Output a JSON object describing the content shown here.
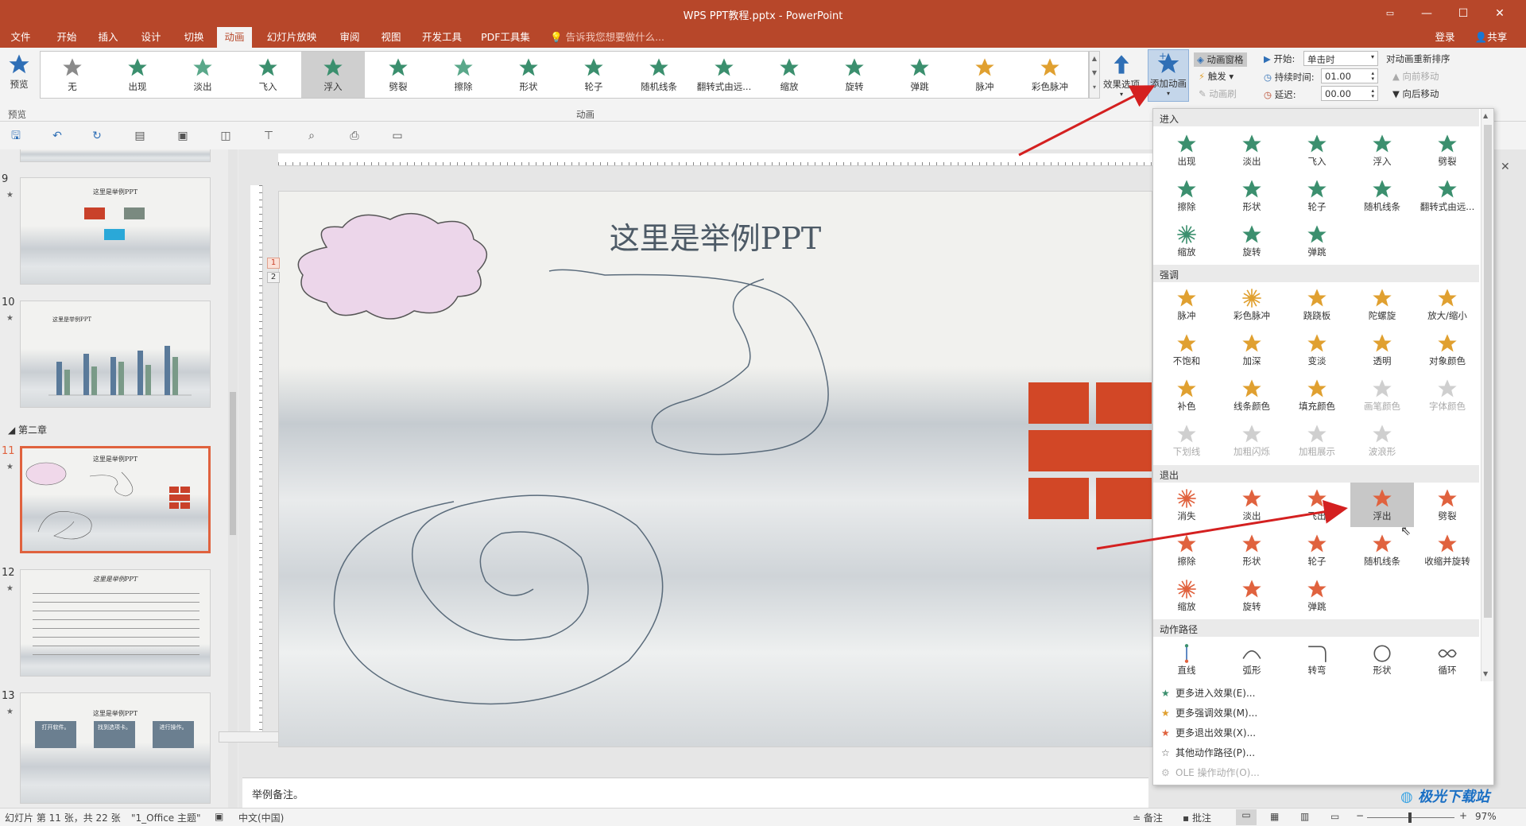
{
  "window": {
    "title": "WPS PPT教程.pptx - PowerPoint"
  },
  "menu": {
    "tabs": [
      "文件",
      "开始",
      "插入",
      "设计",
      "切换",
      "动画",
      "幻灯片放映",
      "审阅",
      "视图",
      "开发工具",
      "PDF工具集"
    ],
    "active": "动画",
    "tell_me": "告诉我您想要做什么...",
    "login": "登录",
    "share": "共享"
  },
  "ribbon": {
    "preview_label": "预览",
    "preview_group": "预览",
    "animation_group": "动画",
    "gallery": [
      "无",
      "出现",
      "淡出",
      "飞入",
      "浮入",
      "劈裂",
      "擦除",
      "形状",
      "轮子",
      "随机线条",
      "翻转式由远...",
      "缩放",
      "旋转",
      "弹跳",
      "脉冲",
      "彩色脉冲"
    ],
    "gallery_selected": "浮入",
    "effect_options": "效果选项",
    "add_animation": "添加动画",
    "animation_pane": "动画窗格",
    "trigger": "触发",
    "anim_painter": "动画刷",
    "start_label": "开始:",
    "start_value": "单击时",
    "duration_label": "持续时间:",
    "duration_value": "01.00",
    "delay_label": "延迟:",
    "delay_value": "00.00",
    "reorder_title": "对动画重新排序",
    "move_earlier": "向前移动",
    "move_later": "向后移动"
  },
  "slides": [
    {
      "num": "9",
      "title": "这里是举例PPT"
    },
    {
      "num": "10",
      "title": "这里是举例PPT"
    },
    {
      "num": "11",
      "title": "这里是举例PPT"
    },
    {
      "num": "12",
      "title": "这里是举例PPT"
    },
    {
      "num": "13",
      "title": "这里是举例PPT",
      "boxes": [
        "打开软件。",
        "找到选项卡。",
        "进行操作。"
      ]
    }
  ],
  "section_label": "第二章",
  "slide": {
    "title": "这里是举例PPT",
    "anim_tags": [
      "1",
      "2"
    ]
  },
  "notes": "举例备注。",
  "panel": {
    "sections": [
      "进入",
      "强调",
      "退出",
      "动作路径"
    ],
    "entrance": [
      "出现",
      "淡出",
      "飞入",
      "浮入",
      "劈裂",
      "擦除",
      "形状",
      "轮子",
      "随机线条",
      "翻转式由远...",
      "缩放",
      "旋转",
      "弹跳"
    ],
    "emphasis": [
      "脉冲",
      "彩色脉冲",
      "跷跷板",
      "陀螺旋",
      "放大/缩小",
      "不饱和",
      "加深",
      "变淡",
      "透明",
      "对象颜色",
      "补色",
      "线条颜色",
      "填充颜色",
      "画笔颜色",
      "字体颜色",
      "下划线",
      "加粗闪烁",
      "加粗展示",
      "波浪形"
    ],
    "emphasis_disabled": [
      "画笔颜色",
      "字体颜色",
      "下划线",
      "加粗闪烁",
      "加粗展示",
      "波浪形"
    ],
    "exit": [
      "消失",
      "淡出",
      "飞出",
      "浮出",
      "劈裂",
      "擦除",
      "形状",
      "轮子",
      "随机线条",
      "收缩并旋转",
      "缩放",
      "旋转",
      "弹跳"
    ],
    "exit_highlight": "浮出",
    "paths": [
      "直线",
      "弧形",
      "转弯",
      "形状",
      "循环"
    ],
    "more": [
      "更多进入效果(E)...",
      "更多强调效果(M)...",
      "更多退出效果(X)...",
      "其他动作路径(P)...",
      "OLE 操作动作(O)..."
    ]
  },
  "status": {
    "slide_info": "幻灯片 第 11 张，共 22 张",
    "theme": "\"1_Office 主题\"",
    "lang": "中文(中国)",
    "notes": "备注",
    "comments": "批注",
    "zoom": "97%"
  },
  "watermark": "极光下载站",
  "colors": {
    "brand": "#b7472a",
    "entrance": "#3b8f6e",
    "emphasis": "#e0a030",
    "exit": "#e0623e",
    "arrow": "#d42020"
  }
}
